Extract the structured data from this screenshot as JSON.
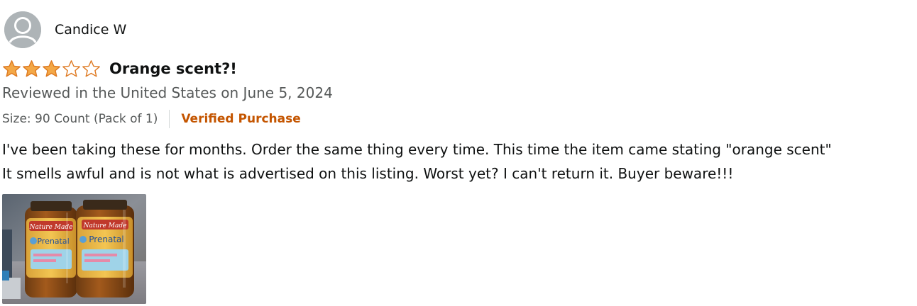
{
  "reviewer": {
    "name": "Candice W",
    "avatar_icon": "default-user-avatar-icon"
  },
  "rating": {
    "value": 3,
    "max": 5,
    "filled_color": "#f3a847",
    "outline_color": "#de7921"
  },
  "review": {
    "title": "Orange scent?!",
    "date_text": "Reviewed in the United States on June 5, 2024",
    "format": "Size: 90 Count (Pack of 1)",
    "badge": "Verified Purchase",
    "badge_color": "#c45500",
    "body_lines": [
      "I've been taking these for months. Order the same thing every time. This time the item came stating \"orange scent\"",
      "It smells awful and is not what is advertised on this listing. Worst yet? I can't return it. Buyer beware!!!"
    ]
  },
  "image": {
    "bottle_label_1": "Nature Made",
    "bottle_label_2": "Prenatal"
  }
}
